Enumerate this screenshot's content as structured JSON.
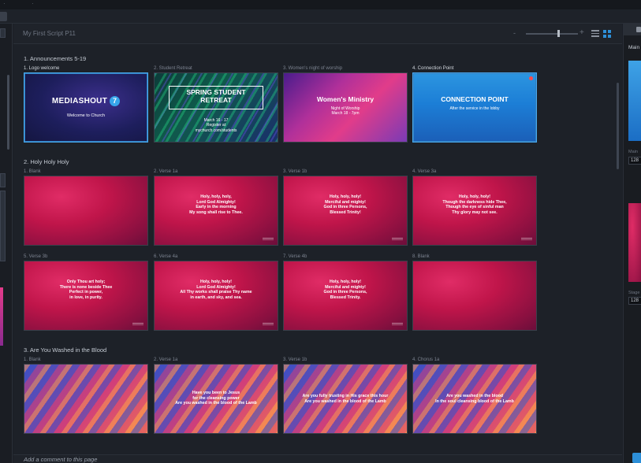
{
  "header": {
    "script_title": "My First Script P11",
    "zoom_minus": "-",
    "zoom_plus": "+"
  },
  "sections": [
    {
      "title": "1. Announcements 5-19",
      "slides": [
        {
          "label": "1. Logo welcome",
          "bg": "navy",
          "selected": true,
          "type": "logo",
          "brand": "MEDIASHOUT",
          "brand_badge": "7",
          "subtitle": "Welcome to Church"
        },
        {
          "label": "2. Student Retreat",
          "bg": "green",
          "type": "retreat",
          "heading": "SPRING STUDENT\nRETREAT",
          "body": "March 16 - 17\nRegister at\nmychurch.com/students"
        },
        {
          "label": "3. Women's night of worship",
          "bg": "pink",
          "type": "promo",
          "heading": "Women's Ministry",
          "body": "Night of Worship\nMarch 18 - 7pm"
        },
        {
          "label": "4. Connection Point",
          "bg": "blue",
          "selected": true,
          "type": "promo",
          "heading": "CONNECTION POINT",
          "body": "After the service in the lobby"
        }
      ]
    },
    {
      "title": "2. Holy Holy Holy",
      "slides": [
        {
          "label": "1. Blank",
          "bg": "red",
          "lyrics": ""
        },
        {
          "label": "2. Verse 1a",
          "bg": "red",
          "lyrics": "Holy, holy, holy,\nLord God Almighty!\nEarly in the morning\nMy song shall rise to Thee."
        },
        {
          "label": "3. Verse 1b",
          "bg": "red",
          "lyrics": "Holy, holy, holy!\nMerciful and mighty!\nGod in three Persons,\nBlessed Trinity!"
        },
        {
          "label": "4. Verse 3a",
          "bg": "red",
          "lyrics": "Holy, holy, holy!\nThough the darkness hide Thee,\nThough the eye of sinful man\nThy glory may not see."
        },
        {
          "label": "5. Verse 3b",
          "bg": "red",
          "lyrics": "Only Thou art holy;\nThere is none beside Thee\nPerfect in power,\nin love, in purity."
        },
        {
          "label": "6. Verse 4a",
          "bg": "red",
          "lyrics": "Holy, holy, holy!\nLord God Almighty!\nAll Thy works shall praise Thy name\nin earth, and sky, and sea."
        },
        {
          "label": "7. Verse 4b",
          "bg": "red",
          "lyrics": "Holy, holy, holy!\nMerciful and mighty!\nGod in three Persons,\nBlessed Trinity."
        },
        {
          "label": "8. Blank",
          "bg": "red",
          "lyrics": ""
        }
      ]
    },
    {
      "title": "3. Are You Washed in the Blood",
      "slides": [
        {
          "label": "1. Blank",
          "bg": "stripe",
          "lyrics": ""
        },
        {
          "label": "2. Verse 1a",
          "bg": "stripe",
          "lyrics": "Have you been to Jesus\nfor the cleansing power\nAre you washed in the blood of the Lamb"
        },
        {
          "label": "3. Verse 1b",
          "bg": "stripe",
          "lyrics": "Are you fully trusting in His grace this hour\nAre you washed in the blood of the Lamb"
        },
        {
          "label": "4. Chorus 1a",
          "bg": "stripe",
          "lyrics": "Are you washed in the blood\nIn the soul cleansing blood of the Lamb"
        }
      ]
    }
  ],
  "comment": {
    "placeholder": "Add a comment to this page"
  },
  "right_panel": {
    "main_label": "Main",
    "main_short": "Main",
    "main_value": "128",
    "stage_label": "Stage",
    "stage_value": "128"
  },
  "colors": {
    "accent": "#2d8fd8",
    "selection": "#4aa9f0",
    "background": "#1b1f26"
  }
}
